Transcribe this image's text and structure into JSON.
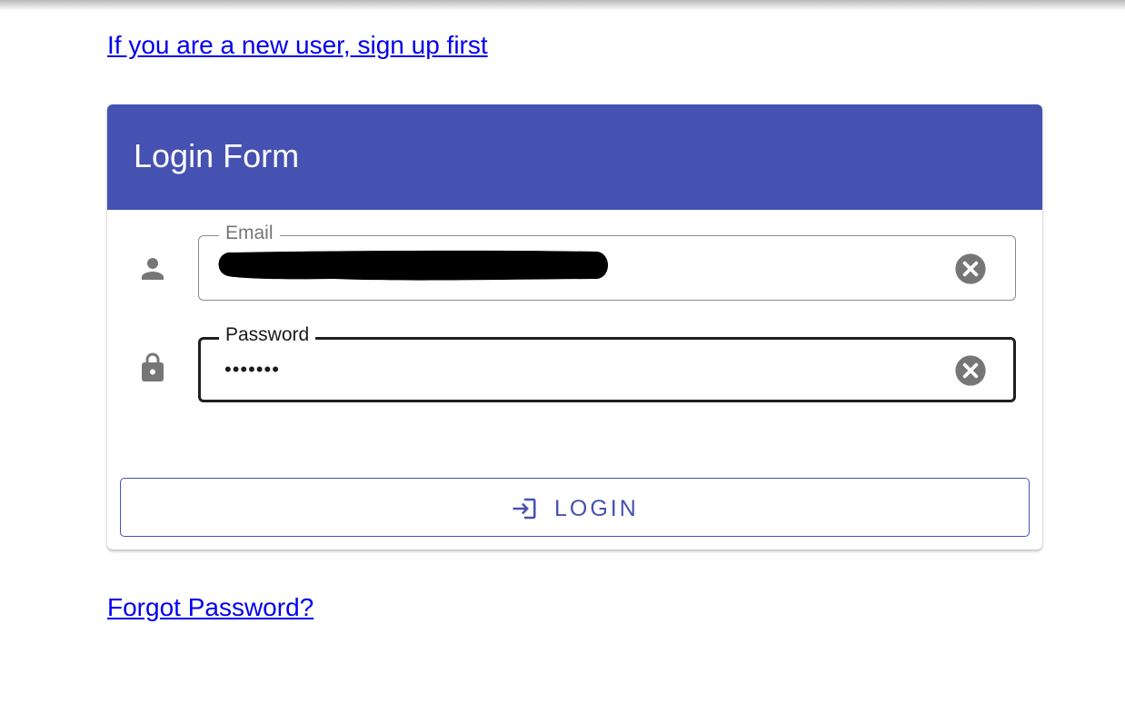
{
  "links": {
    "signup": "If you are a new user, sign up first",
    "forgot_password": "Forgot Password?"
  },
  "form": {
    "title": "Login Form",
    "email": {
      "label": "Email",
      "value": "",
      "icon": "person-icon",
      "clear_icon": "clear-icon",
      "redacted": true
    },
    "password": {
      "label": "Password",
      "value": "•••••••",
      "icon": "lock-icon",
      "clear_icon": "clear-icon"
    },
    "login_button": {
      "label": "LOGIN",
      "icon": "login-icon"
    }
  },
  "colors": {
    "header": "#4652b1",
    "accent": "#4652b1",
    "link": "#0000ee",
    "icon_gray": "#767676"
  }
}
